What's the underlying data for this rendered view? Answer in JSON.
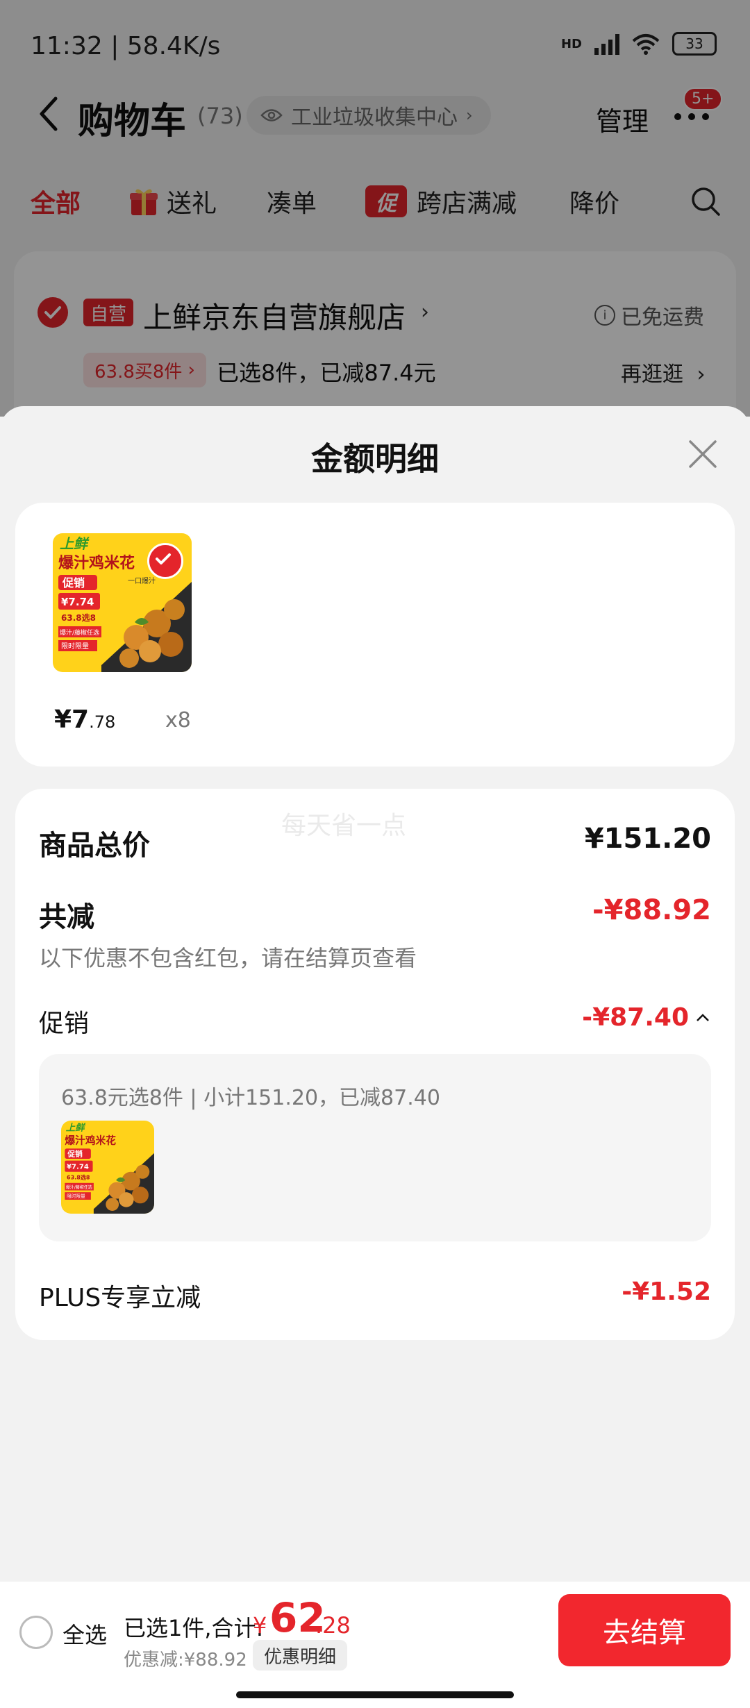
{
  "status_bar": {
    "time": "11:32 | 58.4K/s",
    "battery": "33"
  },
  "header": {
    "title": "购物车",
    "count": "(73)",
    "location": "工业垃圾收集中心",
    "manage": "管理",
    "badge": "5+"
  },
  "tabs": [
    "全部",
    "送礼",
    "凑单",
    "跨店满减",
    "降价"
  ],
  "promo_tag": "促",
  "store": {
    "self_tag": "自营",
    "name": "上鲜京东自营旗舰店",
    "free_shipping": "已免运费",
    "deal_tag": "63.8买8件",
    "deal_text": "已选8件，已减87.4元",
    "browse_more": "再逛逛"
  },
  "sheet": {
    "title": "金额明细",
    "product": {
      "brand": "上鲜",
      "name": "爆汁鸡米花",
      "tagline": "一口爆汁",
      "promo": "促销",
      "price_tag": "¥7.74",
      "deal": "63.8选8",
      "flavor": "爆汁/藤椒任选",
      "limited": "限时限量",
      "price_int": "¥7",
      "price_dec": ".78",
      "qty": "x8"
    },
    "watermark": "每天省一点",
    "total_label": "商品总价",
    "total_value": "¥151.20",
    "reduce_label": "共减",
    "reduce_value": "-¥88.92",
    "note": "以下优惠不包含红包，请在结算页查看",
    "promo_label": "促销",
    "promo_value": "-¥87.40",
    "promo_desc": "63.8元选8件 | 小计151.20，已减87.40",
    "plus_label": "PLUS专享立减",
    "plus_value": "-¥1.52"
  },
  "bottom_bar": {
    "select_all": "全选",
    "selected": "已选1件,合计:",
    "currency": "¥",
    "total_int": "62",
    "total_dec": ".28",
    "discount": "优惠减:¥88.92",
    "detail_chip": "优惠明细",
    "checkout": "去结算"
  },
  "colors": {
    "accent": "#e4252b",
    "checkout": "#f2272e"
  }
}
